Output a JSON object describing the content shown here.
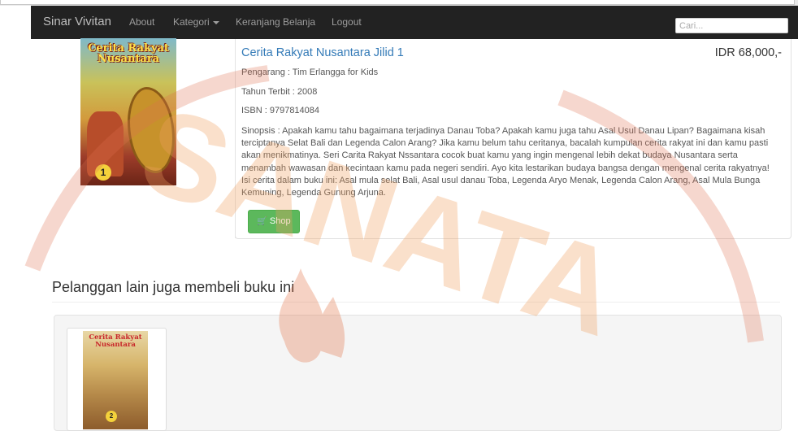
{
  "navbar": {
    "brand": "Sinar Vivitan",
    "items": [
      {
        "label": "About"
      },
      {
        "label": "Kategori"
      },
      {
        "label": "Keranjang Belanja"
      },
      {
        "label": "Logout"
      }
    ],
    "search_placeholder": "Cari..."
  },
  "product": {
    "cover_title": "Cerita Rakyat Nusantara",
    "cover_volume": "1",
    "title": "Cerita Rakyat Nusantara Jilid 1",
    "price": "IDR 68,000,-",
    "author": "Pengarang : Tim Erlangga for Kids",
    "year": "Tahun Terbit : 2008",
    "isbn": "ISBN : 9797814084",
    "synopsis": "Sinopsis : Apakah kamu tahu bagaimana terjadinya Danau Toba? Apakah kamu juga tahu Asal Usul Danau Lipan? Bagaimana kisah terciptanya Selat Bali dan Legenda Calon Arang? Jika kamu belum tahu ceritanya, bacalah kumpulan cerita rakyat ini dan kamu pasti akan menikmatinya. Seri Carita Rakyat Nssantara cocok buat kamu yang ingin mengenal lebih dekat budaya Nusantara serta menambah wawasan dan kecintaan kamu pada negeri sendiri. Ayo kita lestarikan budaya bangsa dengan mengenal cerita rakyatnya! Isi cerita dalam buku ini: Asal mula selat Bali, Asal usul danau Toba, Legenda Aryo Menak, Legenda Calon Arang, Asal Mula Bunga Kemuning, Legenda Gunung Arjuna.",
    "shop_label": "Shop"
  },
  "recommendations": {
    "heading": "Pelanggan lain juga membeli buku ini",
    "items": [
      {
        "cover_title": "Cerita Rakyat Nusantara",
        "volume": "2"
      }
    ]
  },
  "watermark": {
    "text": "SANATA"
  },
  "colors": {
    "navbar_bg": "#222222",
    "link": "#337ab7",
    "shop_button": "#5cb85c",
    "watermark": "#f0a060"
  }
}
